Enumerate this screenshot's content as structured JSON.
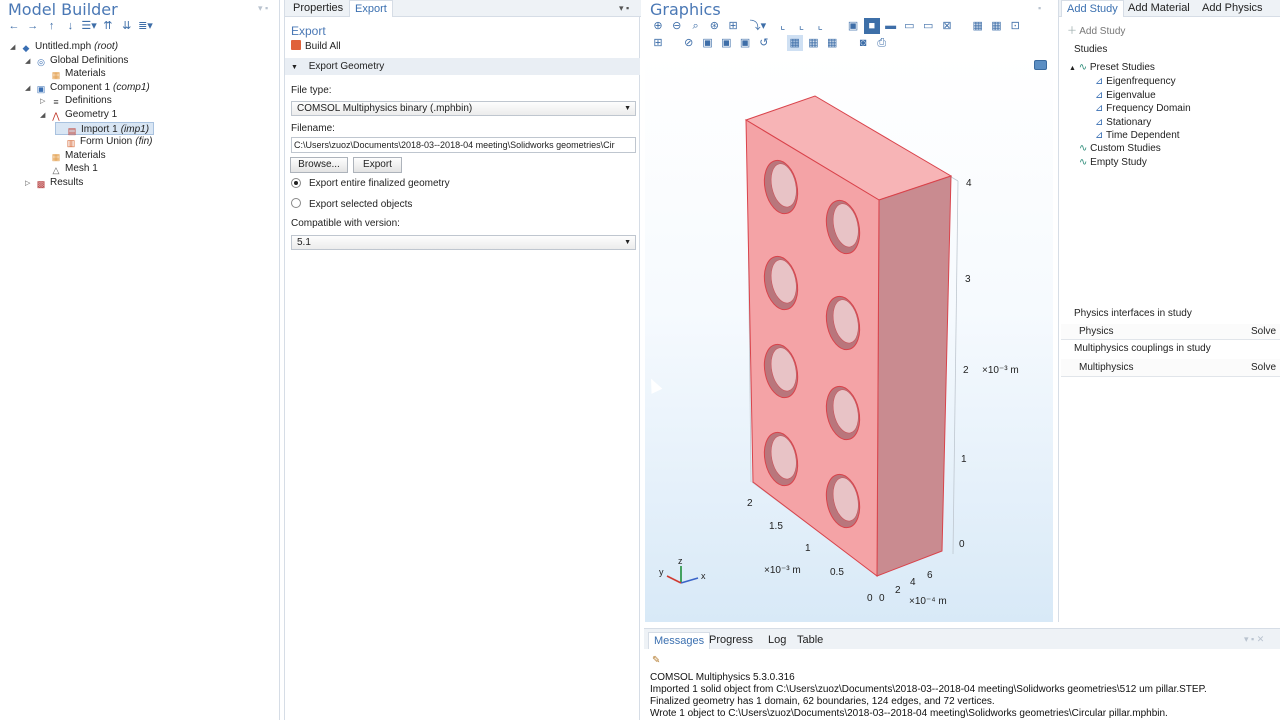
{
  "model_builder": {
    "title": "Model Builder",
    "tree": [
      {
        "label": "Untitled.mph",
        "tag": "(root)",
        "level": 0,
        "toggle": "▲",
        "icon": "model-icon"
      },
      {
        "label": "Global Definitions",
        "tag": "",
        "level": 1,
        "toggle": "▲",
        "icon": "globe-icon"
      },
      {
        "label": "Materials",
        "tag": "",
        "level": 2,
        "toggle": "",
        "icon": "materials-icon"
      },
      {
        "label": "Component 1",
        "tag": "(comp1)",
        "level": 1,
        "toggle": "▲",
        "icon": "component-icon"
      },
      {
        "label": "Definitions",
        "tag": "",
        "level": 2,
        "toggle": "▷",
        "icon": "definitions-icon"
      },
      {
        "label": "Geometry 1",
        "tag": "",
        "level": 2,
        "toggle": "▲",
        "icon": "geometry-icon"
      },
      {
        "label": "Import 1",
        "tag": "(imp1)",
        "level": 3,
        "toggle": "",
        "icon": "import-icon"
      },
      {
        "label": "Form Union",
        "tag": "(fin)",
        "level": 3,
        "toggle": "",
        "icon": "form-union-icon"
      },
      {
        "label": "Materials",
        "tag": "",
        "level": 2,
        "toggle": "",
        "icon": "materials-icon"
      },
      {
        "label": "Mesh 1",
        "tag": "",
        "level": 2,
        "toggle": "",
        "icon": "mesh-icon"
      },
      {
        "label": "Results",
        "tag": "",
        "level": 1,
        "toggle": "▷",
        "icon": "results-icon"
      }
    ]
  },
  "settings": {
    "tab_properties": "Properties",
    "tab_export": "Export",
    "heading": "Export",
    "build_all": "Build All",
    "section": "Export Geometry",
    "file_type_label": "File type:",
    "file_type_value": "COMSOL Multiphysics binary (.mphbin)",
    "filename_label": "Filename:",
    "filename_value": "C:\\Users\\zuoz\\Documents\\2018-03--2018-04 meeting\\Solidworks geometries\\Cir",
    "browse_label": "Browse...",
    "export_label": "Export",
    "radio_1": "Export entire finalized geometry",
    "radio_2": "Export selected objects",
    "compat_label": "Compatible with version:",
    "compat_value": "5.1"
  },
  "graphics": {
    "title": "Graphics",
    "z_ticks": [
      "4",
      "3",
      "2",
      "1",
      "0"
    ],
    "z_unit": "×10⁻³ m",
    "y_ticks": [
      "2",
      "1.5",
      "1",
      "0.5",
      "0"
    ],
    "y_unit": "×10⁻³ m",
    "x_ticks": [
      "0",
      "2",
      "4",
      "6"
    ],
    "x_unit": "×10⁻⁴ m",
    "axis_z": "z",
    "axis_y": "y",
    "axis_x": "x",
    "block_color": "#f4a3a6",
    "side_color": "#c98b90",
    "edge_color": "#d9434b"
  },
  "add_study": {
    "tabs": [
      "Add Study",
      "Add Material",
      "Add Physics"
    ],
    "add_study_button": "Add Study",
    "studies_label": "Studies",
    "preset_studies": "Preset Studies",
    "preset_items": [
      "Eigenfrequency",
      "Eigenvalue",
      "Frequency Domain",
      "Stationary",
      "Time Dependent"
    ],
    "custom_studies": "Custom Studies",
    "empty_study": "Empty Study",
    "physics_interfaces_label": "Physics interfaces in study",
    "physics_header": "Physics",
    "solve_header": "Solve",
    "multiphysics_label": "Multiphysics couplings in study",
    "multiphysics_header": "Multiphysics",
    "solve_header_2": "Solve"
  },
  "messages": {
    "tabs": [
      "Messages",
      "Progress",
      "Log",
      "Table"
    ],
    "lines": [
      "COMSOL Multiphysics 5.3.0.316",
      "Imported 1 solid object from C:\\Users\\zuoz\\Documents\\2018-03--2018-04 meeting\\Solidworks geometries\\512 um pillar.STEP.",
      "Finalized geometry has 1 domain, 62 boundaries, 124 edges, and 72 vertices.",
      "Wrote 1 object to C:\\Users\\zuoz\\Documents\\2018-03--2018-04 meeting\\Solidworks geometries\\Circular pillar.mphbin."
    ]
  }
}
